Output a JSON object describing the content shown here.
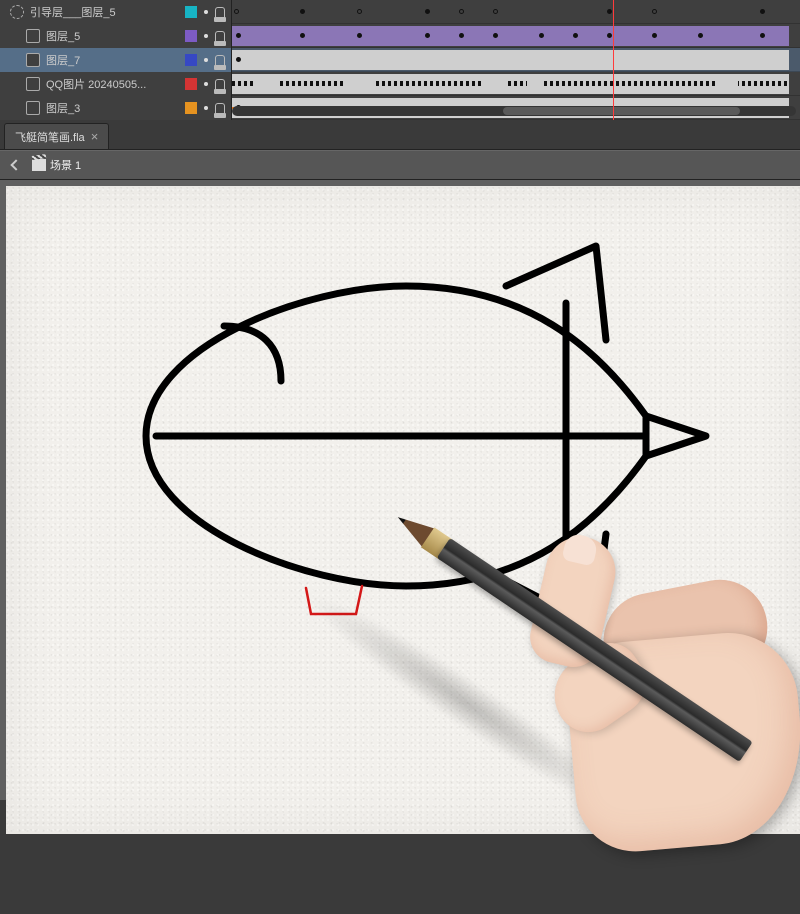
{
  "timeline": {
    "layers": [
      {
        "name": "引导层___图层_5",
        "outline_color": "cyan",
        "kind": "guide",
        "locked": true
      },
      {
        "name": "图层_5",
        "outline_color": "purple",
        "kind": "normal",
        "locked": true
      },
      {
        "name": "图层_7",
        "outline_color": "dkblue",
        "kind": "normal",
        "locked": true,
        "selected": true
      },
      {
        "name": "QQ图片 20240505...",
        "outline_color": "red",
        "kind": "normal",
        "locked": true
      },
      {
        "name": "图层_3",
        "outline_color": "orange",
        "kind": "normal",
        "locked": true
      }
    ],
    "playhead_x_pct": 67
  },
  "document": {
    "tab_title": "飞艇简笔画.fla",
    "scene_label": "场景 1"
  }
}
